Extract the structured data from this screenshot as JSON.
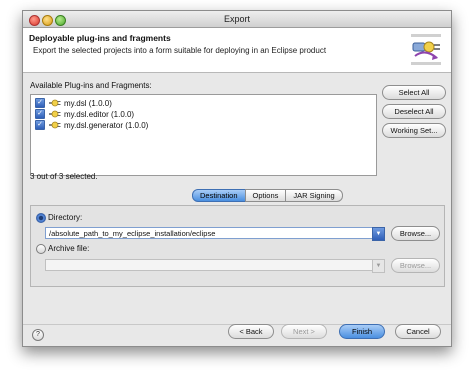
{
  "window": {
    "title": "Export"
  },
  "header": {
    "title": "Deployable plug-ins and fragments",
    "description": "Export the selected projects into a form suitable for deploying in an Eclipse product",
    "icon": "export-wizard-icon"
  },
  "plugins": {
    "label": "Available Plug-ins and Fragments:",
    "items": [
      {
        "label": "my.dsl (1.0.0)",
        "checked": true
      },
      {
        "label": "my.dsl.editor (1.0.0)",
        "checked": true
      },
      {
        "label": "my.dsl.generator (1.0.0)",
        "checked": true
      }
    ],
    "select_all": "Select All",
    "deselect_all": "Deselect All",
    "working_set": "Working Set...",
    "status": "3 out of 3 selected."
  },
  "tabs": [
    {
      "label": "Destination",
      "active": true
    },
    {
      "label": "Options",
      "active": false
    },
    {
      "label": "JAR Signing",
      "active": false
    }
  ],
  "destination": {
    "directory_label": "Directory:",
    "directory_value": "/absolute_path_to_my_eclipse_installation/eclipse",
    "browse": "Browse...",
    "archive_label": "Archive file:",
    "archive_value": "",
    "archive_browse": "Browse..."
  },
  "footer": {
    "help": "?",
    "back": "< Back",
    "next": "Next >",
    "finish": "Finish",
    "cancel": "Cancel"
  },
  "colors": {
    "accent": "#4a8fe0",
    "checkbox": "#2f5fb8"
  }
}
